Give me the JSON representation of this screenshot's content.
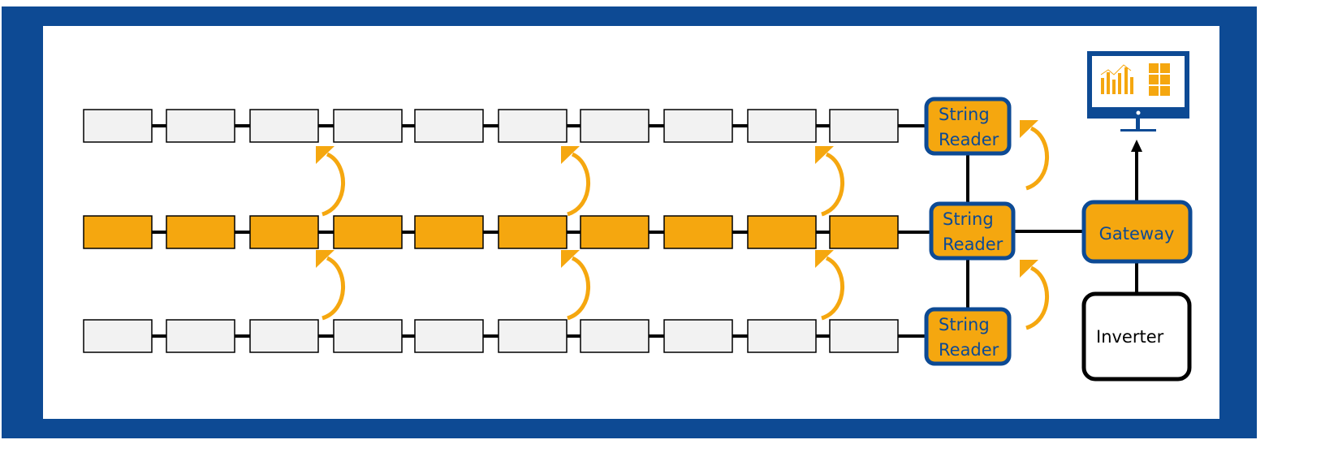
{
  "colors": {
    "frame": "#0d4a94",
    "accent": "#f5a70f",
    "panel": "#f2f2f2",
    "line": "#000000"
  },
  "rows": [
    {
      "state": "normal",
      "panels": 10
    },
    {
      "state": "highlighted",
      "panels": 10
    },
    {
      "state": "normal",
      "panels": 10
    }
  ],
  "string_readers": [
    {
      "label_line1": "String",
      "label_line2": "Reader"
    },
    {
      "label_line1": "String",
      "label_line2": "Reader"
    },
    {
      "label_line1": "String",
      "label_line2": "Reader"
    }
  ],
  "gateway": {
    "label": "Gateway"
  },
  "inverter": {
    "label": "Inverter"
  },
  "monitor": {
    "icon": "monitor-dashboard-icon"
  }
}
